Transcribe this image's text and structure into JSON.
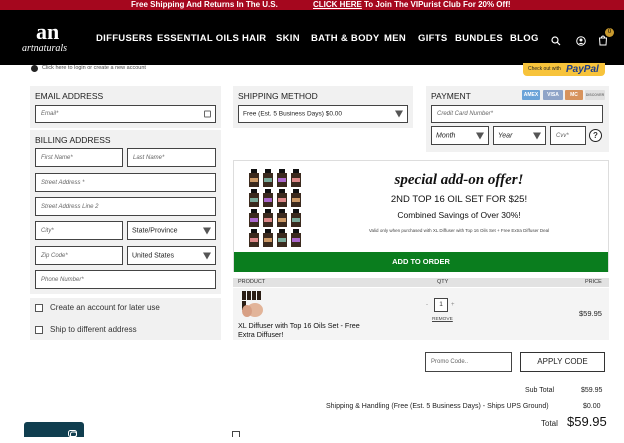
{
  "top_banner": {
    "text": "Free Shipping And Returns In The U.S.",
    "link_text": "CLICK HERE",
    "link_suffix": "To Join The VIPurist Club For 20% Off!"
  },
  "brand": {
    "logo_mark": "an",
    "logo_text": "artnaturals"
  },
  "nav": {
    "items": [
      "DIFFUSERS",
      "ESSENTIAL OILS",
      "HAIR",
      "SKIN",
      "BATH & BODY",
      "MEN",
      "GIFTS",
      "BUNDLES",
      "BLOG"
    ],
    "cart_count": "0"
  },
  "login_hint": "Click here to login or create a new account",
  "paypal": {
    "prefix": "Check out with",
    "name": "PayPal"
  },
  "email": {
    "title": "EMAIL ADDRESS",
    "placeholder": "Email*"
  },
  "billing": {
    "title": "BILLING ADDRESS",
    "first_name": "First Name*",
    "last_name": "Last Name*",
    "street1": "Street Address *",
    "street2": "Street Address Line 2",
    "city": "City*",
    "state": "State/Province",
    "zip": "Zip Code*",
    "country": "United States",
    "phone": "Phone Number*",
    "create_account": "Create an account for later use",
    "ship_different": "Ship to different address"
  },
  "shipping": {
    "title": "SHIPPING METHOD",
    "selected": "Free (Est. 5 Business Days) $0.00"
  },
  "payment": {
    "title": "PAYMENT",
    "card_placeholder": "Credit Card Number*",
    "month": "Month",
    "year": "Year",
    "cvv": "Cvv*",
    "help": "?",
    "cards": [
      "AMEX",
      "VISA",
      "MC",
      "DISCOVER"
    ]
  },
  "offer": {
    "headline": "special add-on offer!",
    "subhead": "2ND TOP 16 OIL SET FOR $25!",
    "savings": "Combined Savings of Over 30%!",
    "fine_print": "Valid only when purchased with XL Diffuser with Top 16 Oils Set + Free Extra Diffuser Deal",
    "button": "ADD TO ORDER"
  },
  "cart": {
    "headers": {
      "product": "PRODUCT",
      "qty": "QTY",
      "price": "PRICE"
    },
    "items": [
      {
        "name": "XL Diffuser with Top 16 Oils Set - Free Extra Diffuser!",
        "qty": "1",
        "minus": "-",
        "plus": "+",
        "remove": "REMOVE",
        "price": "$59.95"
      }
    ]
  },
  "promo": {
    "placeholder": "Promo Code..",
    "button": "APPLY CODE"
  },
  "totals": {
    "subtotal_label": "Sub Total",
    "subtotal": "$59.95",
    "shipping_label": "Shipping & Handling (Free (Est. 5 Business Days) - Ships UPS Ground)",
    "shipping": "$0.00",
    "total_label": "Total",
    "total": "$59.95"
  },
  "colors": {
    "banner": "#a5071e",
    "nav": "#000000",
    "cta": "#0a7d1e",
    "paypal": "#f7c33b"
  }
}
